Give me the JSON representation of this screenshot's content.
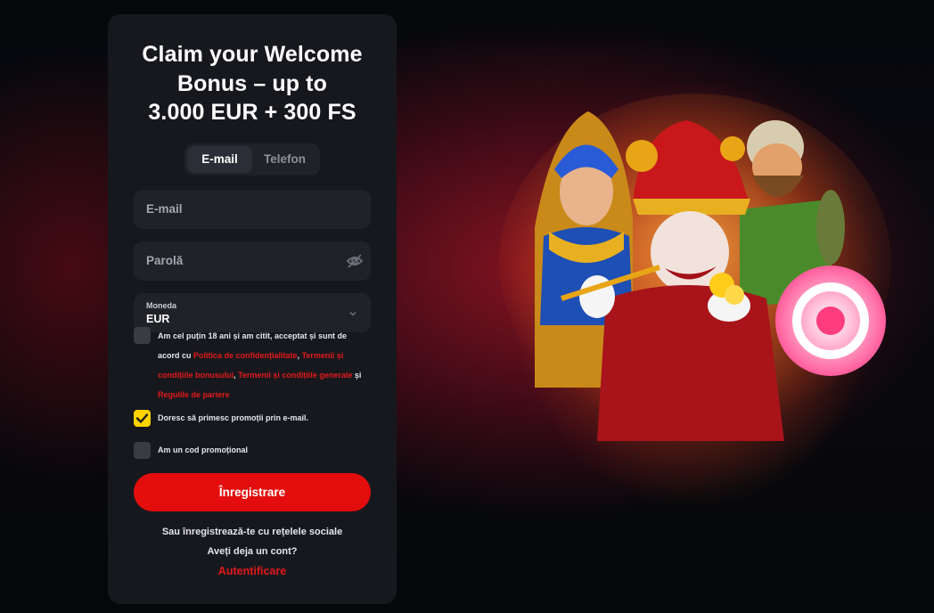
{
  "promo": {
    "title_line1": "Claim your Welcome",
    "title_line2": "Bonus – up to",
    "title_line3": "3.000 EUR + 300 FS"
  },
  "tabs": [
    {
      "label": "E-mail",
      "active": true
    },
    {
      "label": "Telefon",
      "active": false
    }
  ],
  "form": {
    "email_placeholder": "E-mail",
    "password_placeholder": "Parolă",
    "currency_label": "Moneda",
    "currency_value": "EUR"
  },
  "terms": {
    "text_1": "Am cel puțin 18 ani și am citit, acceptat și sunt de acord cu ",
    "link_privacy": "Politica de confidențialitate",
    "sep_1": ", ",
    "link_bonus": "Termenii și condițiile bonusului",
    "sep_2": ", ",
    "link_general": "Termenii și condițiile generale",
    "text_2": " și ",
    "link_betting": "Regulile de pariere",
    "checked": false
  },
  "promo_email": {
    "label": "Doresc să primesc promoții prin e-mail.",
    "checked": true
  },
  "promo_code": {
    "label": "Am un cod promoțional",
    "checked": false
  },
  "actions": {
    "register_label": "Înregistrare",
    "social_text": "Sau înregistrează-te cu rețelele sociale",
    "have_account": "Aveți deja un cont?",
    "login_label": "Autentificare"
  },
  "colors": {
    "accent_red": "#e30d0d",
    "link_red": "#e3191b",
    "checkbox_yellow": "#ffd300",
    "panel_bg": "#17181d",
    "field_bg": "#202228"
  },
  "icons": {
    "password_toggle": "eye-slash-icon",
    "currency_dropdown": "chevron-down-icon",
    "checkbox_mark": "check-icon"
  }
}
